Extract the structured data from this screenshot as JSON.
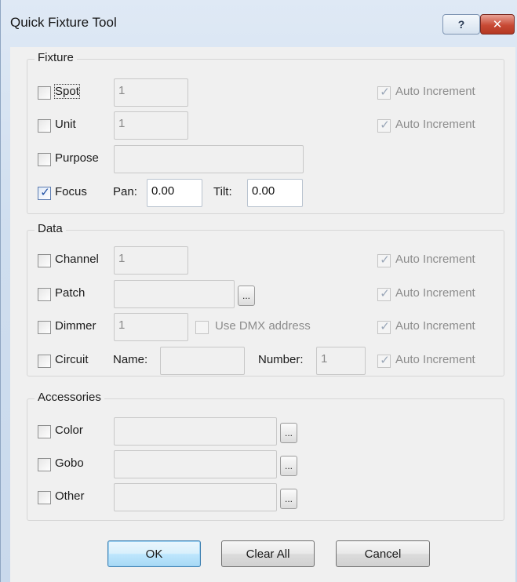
{
  "window": {
    "title": "Quick Fixture Tool",
    "help_glyph": "?",
    "close_glyph": "✕"
  },
  "fixture": {
    "legend": "Fixture",
    "spot": {
      "label": "Spot",
      "checked": false,
      "value": "1",
      "auto_label": "Auto Increment",
      "auto_checked": true
    },
    "unit": {
      "label": "Unit",
      "checked": false,
      "value": "1",
      "auto_label": "Auto Increment",
      "auto_checked": true
    },
    "purpose": {
      "label": "Purpose",
      "checked": false,
      "value": ""
    },
    "focus": {
      "label": "Focus",
      "checked": true,
      "pan_label": "Pan:",
      "pan_value": "0.00",
      "tilt_label": "Tilt:",
      "tilt_value": "0.00"
    }
  },
  "data": {
    "legend": "Data",
    "channel": {
      "label": "Channel",
      "checked": false,
      "value": "1",
      "auto_label": "Auto Increment",
      "auto_checked": true
    },
    "patch": {
      "label": "Patch",
      "checked": false,
      "value": "",
      "browse_label": "...",
      "auto_label": "Auto Increment",
      "auto_checked": true
    },
    "dimmer": {
      "label": "Dimmer",
      "checked": false,
      "value": "1",
      "dmx_label": "Use DMX address",
      "dmx_checked": false,
      "auto_label": "Auto Increment",
      "auto_checked": true
    },
    "circuit": {
      "label": "Circuit",
      "checked": false,
      "name_label": "Name:",
      "name_value": "",
      "number_label": "Number:",
      "number_value": "1",
      "auto_label": "Auto Increment",
      "auto_checked": true
    }
  },
  "accessories": {
    "legend": "Accessories",
    "color": {
      "label": "Color",
      "checked": false,
      "value": "",
      "browse_label": "..."
    },
    "gobo": {
      "label": "Gobo",
      "checked": false,
      "value": "",
      "browse_label": "..."
    },
    "other": {
      "label": "Other",
      "checked": false,
      "value": "",
      "browse_label": "..."
    }
  },
  "buttons": {
    "ok": "OK",
    "clear_all": "Clear All",
    "cancel": "Cancel"
  },
  "colors": {
    "title_bar": "#cfdeef",
    "dialog_bg": "#f0f0f0",
    "check_blue": "#1d4ea3",
    "close_red": "#c84a35"
  }
}
